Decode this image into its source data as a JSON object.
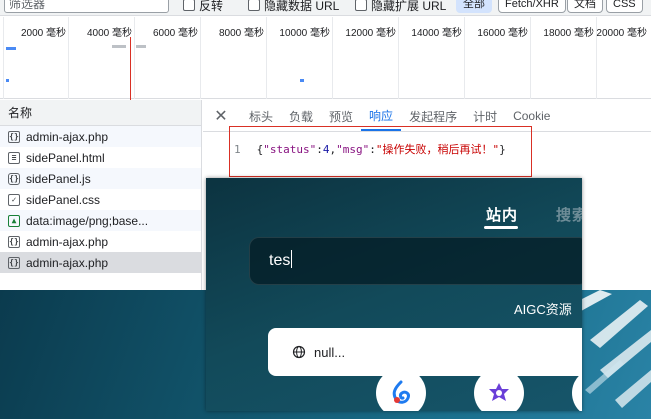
{
  "filter_bar": {
    "filter_placeholder": "筛选器",
    "invert_label": "反转",
    "hide_data_urls_label": "隐藏数据 URL",
    "hide_extension_urls_label": "隐藏扩展 URL",
    "type_buttons": [
      "全部",
      "Fetch/XHR",
      "文档",
      "CSS"
    ]
  },
  "timeline": {
    "unit": "毫秒",
    "ticks": [
      "2000",
      "4000",
      "6000",
      "8000",
      "10000",
      "12000",
      "14000",
      "16000",
      "18000",
      "20000"
    ]
  },
  "request_list": {
    "header": "名称",
    "rows": [
      {
        "name": "admin-ajax.php",
        "icon": "code-icon"
      },
      {
        "name": "sidePanel.html",
        "icon": "document-icon"
      },
      {
        "name": "sidePanel.js",
        "icon": "script-icon"
      },
      {
        "name": "sidePanel.css",
        "icon": "stylesheet-icon"
      },
      {
        "name": "data:image/png;base...",
        "icon": "image-icon"
      },
      {
        "name": "admin-ajax.php",
        "icon": "code-icon"
      },
      {
        "name": "admin-ajax.php",
        "icon": "code-icon"
      }
    ]
  },
  "detail": {
    "tabs": [
      "标头",
      "负载",
      "预览",
      "响应",
      "发起程序",
      "计时",
      "Cookie"
    ],
    "active_tab": "响应",
    "response": {
      "line_number": "1",
      "open": "{",
      "key_status": "\"status\"",
      "colon1": ":",
      "value_status": "4",
      "comma": ",",
      "key_msg": "\"msg\"",
      "colon2": ":",
      "value_msg": "\"操作失败，稍后再试！\"",
      "close": "}"
    }
  },
  "overlay": {
    "tab_site": "站内",
    "tab_search": "搜索",
    "query": "tes",
    "aigc_label": "AIGC资源",
    "suggestion": "null..."
  },
  "colors": {
    "accent": "#1a73e8",
    "error_red": "#d93025",
    "overlay_bg": "#124a5a"
  }
}
